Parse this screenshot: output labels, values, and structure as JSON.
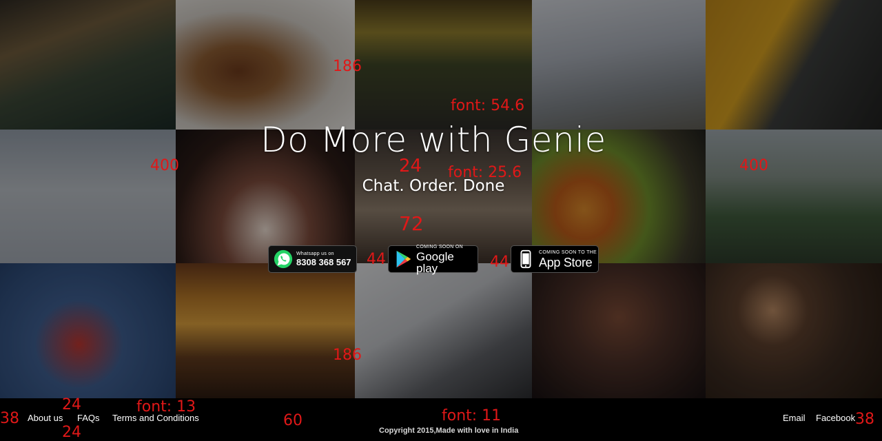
{
  "hero": {
    "title": "Do More with Genie",
    "subtitle": "Chat. Order. Done"
  },
  "badges": {
    "whatsapp": {
      "small": "Whatsapp us on",
      "big": "8308 368 567"
    },
    "google_play": {
      "small": "COMING SOON ON",
      "big": "Google play"
    },
    "app_store": {
      "small": "COMING SOON TO THE",
      "big": "App Store"
    }
  },
  "annotations": {
    "a186_top": "186",
    "a186_bottom": "186",
    "font_54": "font: 54.6",
    "a400_left": "400",
    "a400_right": "400",
    "a24_hero": "24",
    "font_25": "font: 25.6",
    "a72": "72",
    "a44_left": "44",
    "a44_right": "44",
    "a24_footer_top": "24",
    "a24_footer_bottom": "24",
    "font_13": "font: 13",
    "a38_left": "38",
    "a38_right": "38",
    "a60": "60",
    "font_11": "font: 11"
  },
  "footer": {
    "links_left": [
      "About us",
      "FAQs",
      "Terms and Conditions"
    ],
    "links_right": [
      "Email",
      "Facebook"
    ],
    "copyright": "Copyright 2015,Made with love in India"
  },
  "colors": {
    "annotation": "#e01818",
    "background": "#000000",
    "whatsapp_green": "#25d366"
  },
  "icons": [
    "whatsapp-icon",
    "google-play-icon",
    "apple-icon"
  ]
}
